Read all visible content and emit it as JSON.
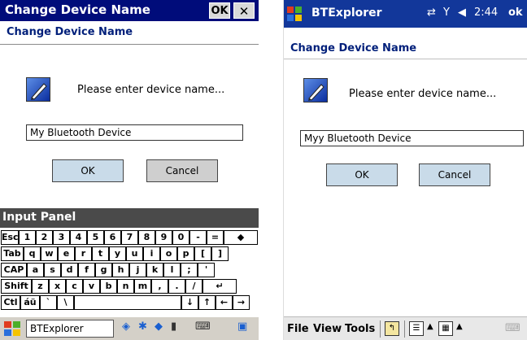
{
  "left": {
    "titlebar": {
      "title": "Change Device Name",
      "ok": "OK",
      "close": "✕"
    },
    "heading": "Change Device Name",
    "prompt": "Please enter device name...",
    "device_name_value": "My Bluetooth Device",
    "ok_button": "OK",
    "cancel_button": "Cancel",
    "input_panel": {
      "label": "Input Panel",
      "rows": [
        [
          "Esc",
          "1",
          "2",
          "3",
          "4",
          "5",
          "6",
          "7",
          "8",
          "9",
          "0",
          "-",
          "=",
          "◆"
        ],
        [
          "Tab",
          "q",
          "w",
          "e",
          "r",
          "t",
          "y",
          "u",
          "i",
          "o",
          "p",
          "[",
          "]"
        ],
        [
          "CAP",
          "a",
          "s",
          "d",
          "f",
          "g",
          "h",
          "j",
          "k",
          "l",
          ";",
          "'"
        ],
        [
          "Shift",
          "z",
          "x",
          "c",
          "v",
          "b",
          "n",
          "m",
          ",",
          ".",
          "/",
          "↵"
        ],
        [
          "Ctl",
          "áü",
          "`",
          "\\",
          "",
          "↓",
          "↑",
          "←",
          "→"
        ]
      ]
    },
    "taskbar": {
      "task": "BTExplorer"
    }
  },
  "right": {
    "topbar": {
      "app": "BTExplorer",
      "time": "2:44",
      "ok": "ok"
    },
    "heading": "Change Device Name",
    "prompt": "Please enter device name...",
    "device_name_value": "Myy Bluetooth Device",
    "ok_button": "OK",
    "cancel_button": "Cancel",
    "menu": {
      "file": "File",
      "view": "View",
      "tools": "Tools"
    }
  },
  "colors": {
    "title_blue": "#000c7a",
    "heading_blue": "#001f7a",
    "top_blue": "#12379a",
    "button_blue": "#c9dbe9"
  }
}
